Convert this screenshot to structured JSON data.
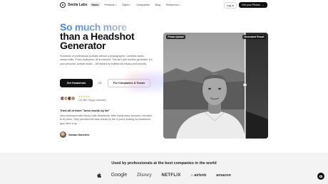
{
  "brand": {
    "name": "Swola Labs"
  },
  "nav": {
    "links": [
      {
        "label": "Home",
        "active": true,
        "dropdown": false
      },
      {
        "label": "Products",
        "active": false,
        "dropdown": true
      },
      {
        "label": "Styles",
        "active": false,
        "dropdown": true
      },
      {
        "label": "Companies",
        "active": false,
        "dropdown": false
      },
      {
        "label": "Blog",
        "active": false,
        "dropdown": false
      },
      {
        "label": "Resources",
        "active": false,
        "dropdown": true
      }
    ],
    "login_label": "Log in",
    "cta_label": "Get your Photos",
    "cta_icon": "arrow-right-icon"
  },
  "hero": {
    "headline_line1": "So much more",
    "headline_line2": "than a Headshot",
    "headline_line3": "Generator",
    "description": "Hundreds of professional portraits without a photographer. Limitless styles, instant edits. Photo replication. All in minutes. This isn't just another generator. It's your personal, portrait studio... All backed by bulletproof privacy and security.",
    "primary_button": "Get Headshots",
    "or_text": "OR",
    "secondary_button": "For Companies & Teams",
    "social_proof": {
      "stars": "★★★★★",
      "text": "116,386+ Happy customers"
    }
  },
  "testimonial": {
    "title": "Tried all of them \"best results by far\"",
    "text": "Very impressed with Swola Labs Headshots. After trying many services I decided to try them. They provided the best results by far! If you're looking for headshots, give them a try.",
    "author": "Sanato Sanchez"
  },
  "photo_compare": {
    "left_tag": "Photo Upload",
    "right_tag": "Generated Result"
  },
  "logos_section": {
    "title": "Used by professionals at the best companies in the world",
    "brands": [
      "Google",
      "Disney",
      "NETFLIX",
      "airbnb",
      "amazon"
    ]
  },
  "colors": {
    "headline_gradient_start": "#3b82f6",
    "dark": "#111111",
    "star": "#f5a524"
  }
}
